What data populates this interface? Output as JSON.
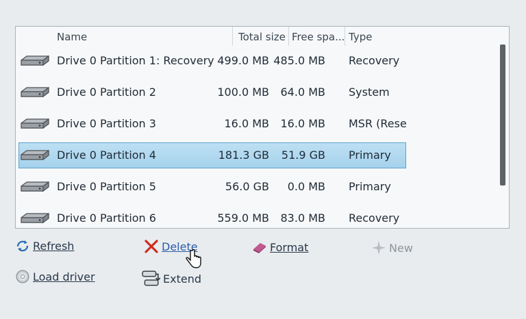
{
  "columns": {
    "name": "Name",
    "total": "Total size",
    "free": "Free spa...",
    "type": "Type"
  },
  "partitions": [
    {
      "name": "Drive 0 Partition 1: Recovery",
      "total": "499.0 MB",
      "free": "485.0 MB",
      "type": "Recovery"
    },
    {
      "name": "Drive 0 Partition 2",
      "total": "100.0 MB",
      "free": "64.0 MB",
      "type": "System"
    },
    {
      "name": "Drive 0 Partition 3",
      "total": "16.0 MB",
      "free": "16.0 MB",
      "type": "MSR (Reser"
    },
    {
      "name": "Drive 0 Partition 4",
      "total": "181.3 GB",
      "free": "51.9 GB",
      "type": "Primary",
      "selected": true
    },
    {
      "name": "Drive 0 Partition 5",
      "total": "56.0 GB",
      "free": "0.0 MB",
      "type": "Primary"
    },
    {
      "name": "Drive 0 Partition 6",
      "total": "559.0 MB",
      "free": "83.0 MB",
      "type": "Recovery"
    }
  ],
  "actions": {
    "refresh": "Refresh",
    "delete": "Delete",
    "format": "Format",
    "new": "New",
    "load_driver": "Load driver",
    "extend": "Extend"
  },
  "colors": {
    "selection": "#a6d2ec",
    "selection_border": "#5aa2d0",
    "delete_icon": "#d12c1f",
    "format_icon": "#b4447a"
  }
}
